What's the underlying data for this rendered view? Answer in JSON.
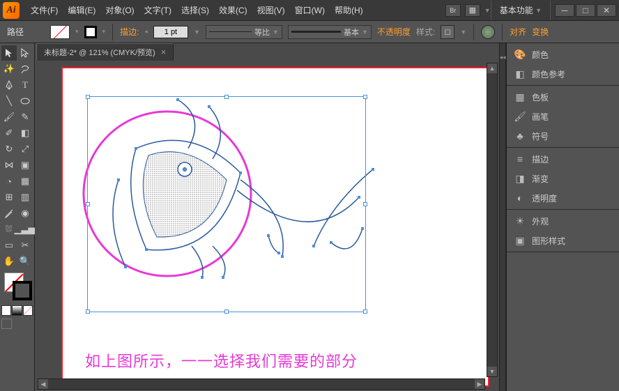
{
  "app": {
    "name": "Ai"
  },
  "menu": {
    "items": [
      "文件(F)",
      "编辑(E)",
      "对象(O)",
      "文字(T)",
      "选择(S)",
      "效果(C)",
      "视图(V)",
      "窗口(W)",
      "帮助(H)"
    ]
  },
  "workspace": {
    "label": "基本功能"
  },
  "controlbar": {
    "selection": "路径",
    "stroke_label": "描边:",
    "stroke_pt": "1 pt",
    "profile": "等比",
    "brush": "基本",
    "opacity_label": "不透明度",
    "style_label": "样式:",
    "align": "对齐",
    "transform": "变换"
  },
  "tab": {
    "title": "未标题-2* @ 121% (CMYK/预览)"
  },
  "canvas": {
    "caption": "如上图所示，一一选择我们需要的部分"
  },
  "panels": {
    "group1": [
      {
        "icon": "palette",
        "label": "颜色"
      },
      {
        "icon": "guide",
        "label": "颜色参考"
      }
    ],
    "group2": [
      {
        "icon": "swatches",
        "label": "色板"
      },
      {
        "icon": "brushes",
        "label": "画笔"
      },
      {
        "icon": "symbols",
        "label": "符号"
      }
    ],
    "group3": [
      {
        "icon": "stroke",
        "label": "描边"
      },
      {
        "icon": "gradient",
        "label": "渐变"
      },
      {
        "icon": "transparency",
        "label": "透明度"
      }
    ],
    "group4": [
      {
        "icon": "appearance",
        "label": "外观"
      },
      {
        "icon": "graphic-styles",
        "label": "图形样式"
      }
    ]
  }
}
